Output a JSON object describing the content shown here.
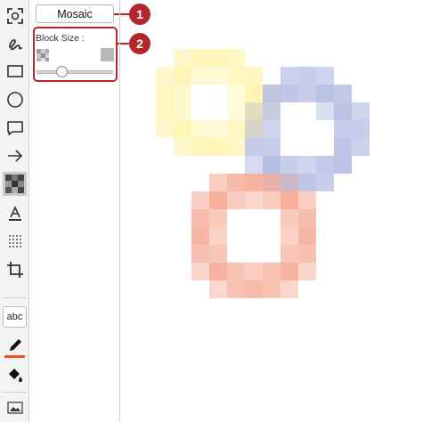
{
  "toolbar": {
    "tools": [
      {
        "name": "region-select-tool",
        "icon": "region-select-icon",
        "active": false
      },
      {
        "name": "freehand-tool",
        "icon": "freehand-squiggle-icon",
        "active": false
      },
      {
        "name": "rectangle-tool",
        "icon": "rectangle-icon",
        "active": false
      },
      {
        "name": "ellipse-tool",
        "icon": "ellipse-icon",
        "active": false
      },
      {
        "name": "speech-bubble-tool",
        "icon": "speech-bubble-icon",
        "active": false
      },
      {
        "name": "arrow-tool",
        "icon": "arrow-icon",
        "active": false
      },
      {
        "name": "mosaic-tool",
        "icon": "mosaic-icon",
        "active": true
      },
      {
        "name": "text-style-tool",
        "icon": "text-underline-icon",
        "active": false
      },
      {
        "name": "dot-pattern-tool",
        "icon": "dot-pattern-icon",
        "active": false
      },
      {
        "name": "crop-tool",
        "icon": "crop-icon",
        "active": false
      }
    ],
    "text_tool_label": "abc",
    "pen_color": "#f05022",
    "bottom_icons": [
      "pen-icon",
      "fill-bucket-icon",
      "image-icon"
    ]
  },
  "options_panel": {
    "mode_label": "Mosaic",
    "block_size_label": "Block Size :",
    "block_size_value": 0.3
  },
  "callouts": [
    "1",
    "2"
  ],
  "accent_color": "#b3262c",
  "mosaic_colors": {
    "yellow_ring": "#fff3a8",
    "blue_ring": "#a9b2de",
    "red_ring": "#f5a58e"
  }
}
